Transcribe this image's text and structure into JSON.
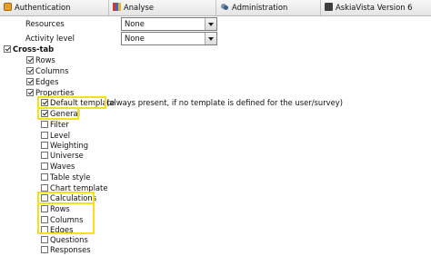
{
  "tabs": [
    {
      "label": "Authentication",
      "icon": "key-icon"
    },
    {
      "label": "Analyse",
      "icon": "analyse-icon"
    },
    {
      "label": "Administration",
      "icon": "admin-icon"
    },
    {
      "label": "AskiaVista Version 6",
      "icon": "askia-icon"
    }
  ],
  "settings": {
    "resources_label": "Resources",
    "resources_value": "None",
    "activity_label": "Activity level",
    "activity_value": "None"
  },
  "tree": [
    {
      "id": "cross-tab",
      "label": "Cross-tab",
      "checked": true,
      "bold": true
    },
    {
      "id": "rows",
      "label": "Rows",
      "checked": true
    },
    {
      "id": "columns",
      "label": "Columns",
      "checked": true
    },
    {
      "id": "edges",
      "label": "Edges",
      "checked": true
    },
    {
      "id": "properties",
      "label": "Properties",
      "checked": true
    },
    {
      "id": "default-template",
      "label": "Default template",
      "note": "(always present, if no template is defined for the user/survey)",
      "checked": true
    },
    {
      "id": "general",
      "label": "General",
      "checked": true
    },
    {
      "id": "filter",
      "label": "Filter",
      "checked": false
    },
    {
      "id": "level",
      "label": "Level",
      "checked": false
    },
    {
      "id": "weighting",
      "label": "Weighting",
      "checked": false
    },
    {
      "id": "universe",
      "label": "Universe",
      "checked": false
    },
    {
      "id": "waves",
      "label": "Waves",
      "checked": false
    },
    {
      "id": "table-style",
      "label": "Table style",
      "checked": false
    },
    {
      "id": "chart-template",
      "label": "Chart template",
      "checked": false
    },
    {
      "id": "calculations",
      "label": "Calculations",
      "checked": false
    },
    {
      "id": "props-rows",
      "label": "Rows",
      "checked": false
    },
    {
      "id": "props-columns",
      "label": "Columns",
      "checked": false
    },
    {
      "id": "props-edges",
      "label": "Edges",
      "checked": false
    },
    {
      "id": "questions",
      "label": "Questions",
      "checked": false
    },
    {
      "id": "responses",
      "label": "Responses",
      "checked": false
    }
  ],
  "colors": {
    "highlight": "#f2e11c"
  }
}
